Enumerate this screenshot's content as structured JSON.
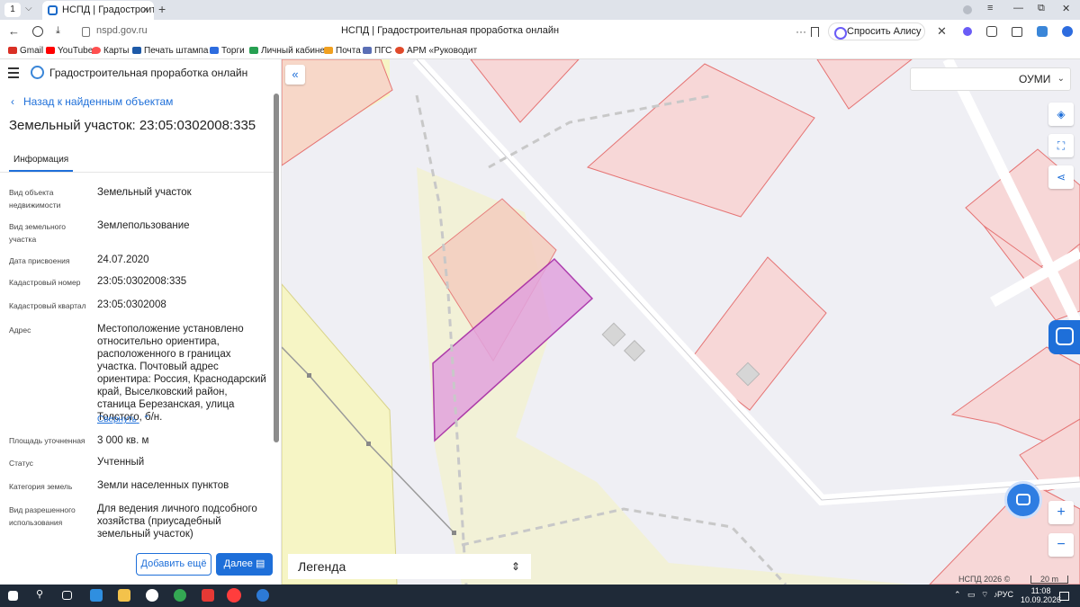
{
  "browser": {
    "tab_number": "1",
    "tab_dropdown": "⌵",
    "tab_title": "НСПД | Градостроительн",
    "tab_close": "×",
    "new_tab": "+",
    "url": "nspd.gov.ru",
    "page_title": "НСПД | Градостроительная проработка онлайн",
    "alisa": "Спросить Алису AI",
    "win_min": "—",
    "win_max": "⧉",
    "win_close": "✕",
    "menu": "≡",
    "bookmarks": [
      {
        "label": "Gmail",
        "color": "#d93025"
      },
      {
        "label": "YouTube",
        "color": "#ff0000"
      },
      {
        "label": "Карты",
        "color": "#ff5050"
      },
      {
        "label": "Печать штампа с",
        "color": "#1e5aa8"
      },
      {
        "label": "Торги",
        "color": "#2d6cdf"
      },
      {
        "label": "Личный кабинет",
        "color": "#27a052"
      },
      {
        "label": "Почта",
        "color": "#f0a020"
      },
      {
        "label": "ПГС",
        "color": "#5b6fb5"
      },
      {
        "label": "АРМ «Руководит",
        "color": "#e04a2a"
      }
    ]
  },
  "app": {
    "title": "Градостроительная проработка онлайн",
    "back": "Назад к найденным объектам",
    "object_title": "Земельный участок: 23:05:0302008:335",
    "tab": "Информация",
    "rows": [
      {
        "label": "Вид объекта недвижимости",
        "value": "Земельный участок"
      },
      {
        "label": "Вид земельного участка",
        "value": "Землепользование"
      },
      {
        "label": "Дата присвоения",
        "value": "24.07.2020"
      },
      {
        "label": "Кадастровый номер",
        "value": "23:05:0302008:335"
      },
      {
        "label": "Кадастровый квартал",
        "value": "23:05:0302008"
      },
      {
        "label": "Адрес",
        "value": "Местоположение установлено относительно ориентира, расположенного в границах участка. Почтовый адрес ориентира: Россия, Краснодарский край, Выселковский район, станица Березанская, улица Толстого, б/н."
      },
      {
        "label": "Площадь уточненная",
        "value": "3 000 кв. м"
      },
      {
        "label": "Статус",
        "value": "Учтенный"
      },
      {
        "label": "Категория земель",
        "value": "Земли населенных пунктов"
      },
      {
        "label": "Вид разрешенного использования",
        "value": "Для ведения личного подсобного хозяйства (приусадебный земельный участок)"
      }
    ],
    "collapse_link": "Свернуть",
    "btn_add": "Добавить ещё",
    "btn_next": "Далее"
  },
  "map": {
    "layer_select": "ОУМИ",
    "legend": "Легенда",
    "attribution": "НСПД 2026 ©",
    "scale": "20 m",
    "zoom_in": "+",
    "zoom_out": "−",
    "colors": {
      "parcel_fill": "#f7d7d7",
      "parcel_stroke": "#e57373",
      "selected_fill": "#e2a3de",
      "selected_stroke": "#a21ea2",
      "zone_yellow": "#f6f5c5",
      "road": "#ffffff"
    }
  },
  "taskbar": {
    "lang": "РУС",
    "time": "11:08",
    "date": "10.09.2026"
  }
}
